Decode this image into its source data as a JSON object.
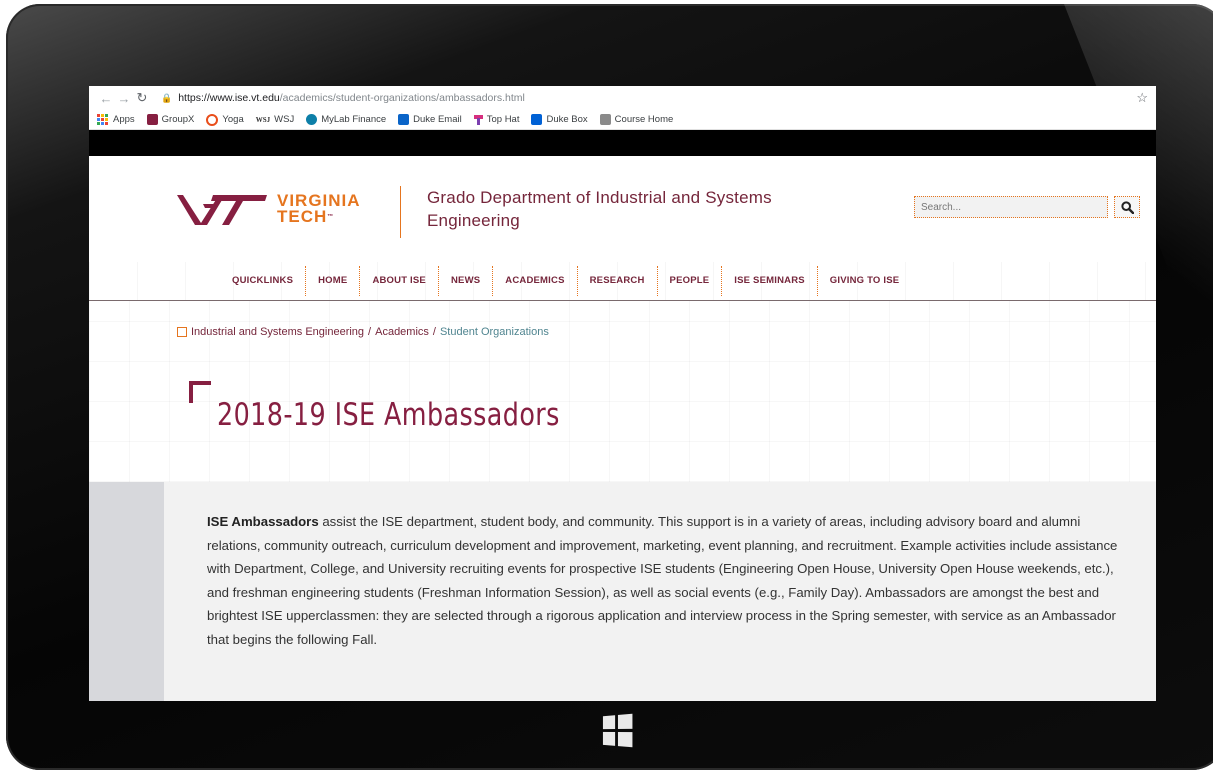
{
  "browser": {
    "url_host": "https://www.ise.vt.edu",
    "url_path": "/academics/student-organizations/ambassadors.html",
    "bookmarks": [
      {
        "label": "Apps",
        "icon": "apps-grid-icon"
      },
      {
        "label": "GroupX",
        "icon": "vt-icon"
      },
      {
        "label": "Yoga",
        "icon": "yoga-ring-icon"
      },
      {
        "label": "WSJ",
        "icon": "wsj-icon"
      },
      {
        "label": "MyLab Finance",
        "icon": "pearson-icon"
      },
      {
        "label": "Duke Email",
        "icon": "outlook-icon"
      },
      {
        "label": "Top Hat",
        "icon": "tophat-icon"
      },
      {
        "label": "Duke Box",
        "icon": "box-icon"
      },
      {
        "label": "Course Home",
        "icon": "course-icon"
      }
    ]
  },
  "header": {
    "logo_line1": "VIRGINIA",
    "logo_line2": "TECH",
    "logo_tm": "™",
    "dept_name": "Grado Department of Industrial and Systems Engineering",
    "search_placeholder": "Search..."
  },
  "nav": {
    "items": [
      "QUICKLINKS",
      "HOME",
      "ABOUT ISE",
      "NEWS",
      "ACADEMICS",
      "RESEARCH",
      "PEOPLE",
      "ISE SEMINARS",
      "GIVING TO ISE"
    ]
  },
  "breadcrumb": {
    "items": [
      "Industrial and Systems Engineering",
      "Academics"
    ],
    "current": "Student Organizations",
    "separator": "/"
  },
  "page": {
    "title": "2018-19 ISE Ambassadors",
    "intro_bold": "ISE Ambassadors",
    "intro_text": " assist the ISE department, student body, and community. This support is in a variety of areas, including advisory board and alumni relations, community outreach, curriculum development and improvement, marketing, event planning, and recruitment. Example activities include assistance with Department, College, and University recruiting events for prospective ISE students (Engineering Open House, University Open House weekends, etc.), and freshman engineering students (Freshman Information Session), as well as social events (e.g., Family Day). Ambassadors are amongst the best and brightest ISE upperclassmen: they are selected through a rigorous application and interview process in the Spring semester, with service as an Ambassador that begins the following Fall."
  },
  "colors": {
    "maroon": "#861f41",
    "orange": "#e5751f",
    "breadcrumb_current": "#508590"
  }
}
